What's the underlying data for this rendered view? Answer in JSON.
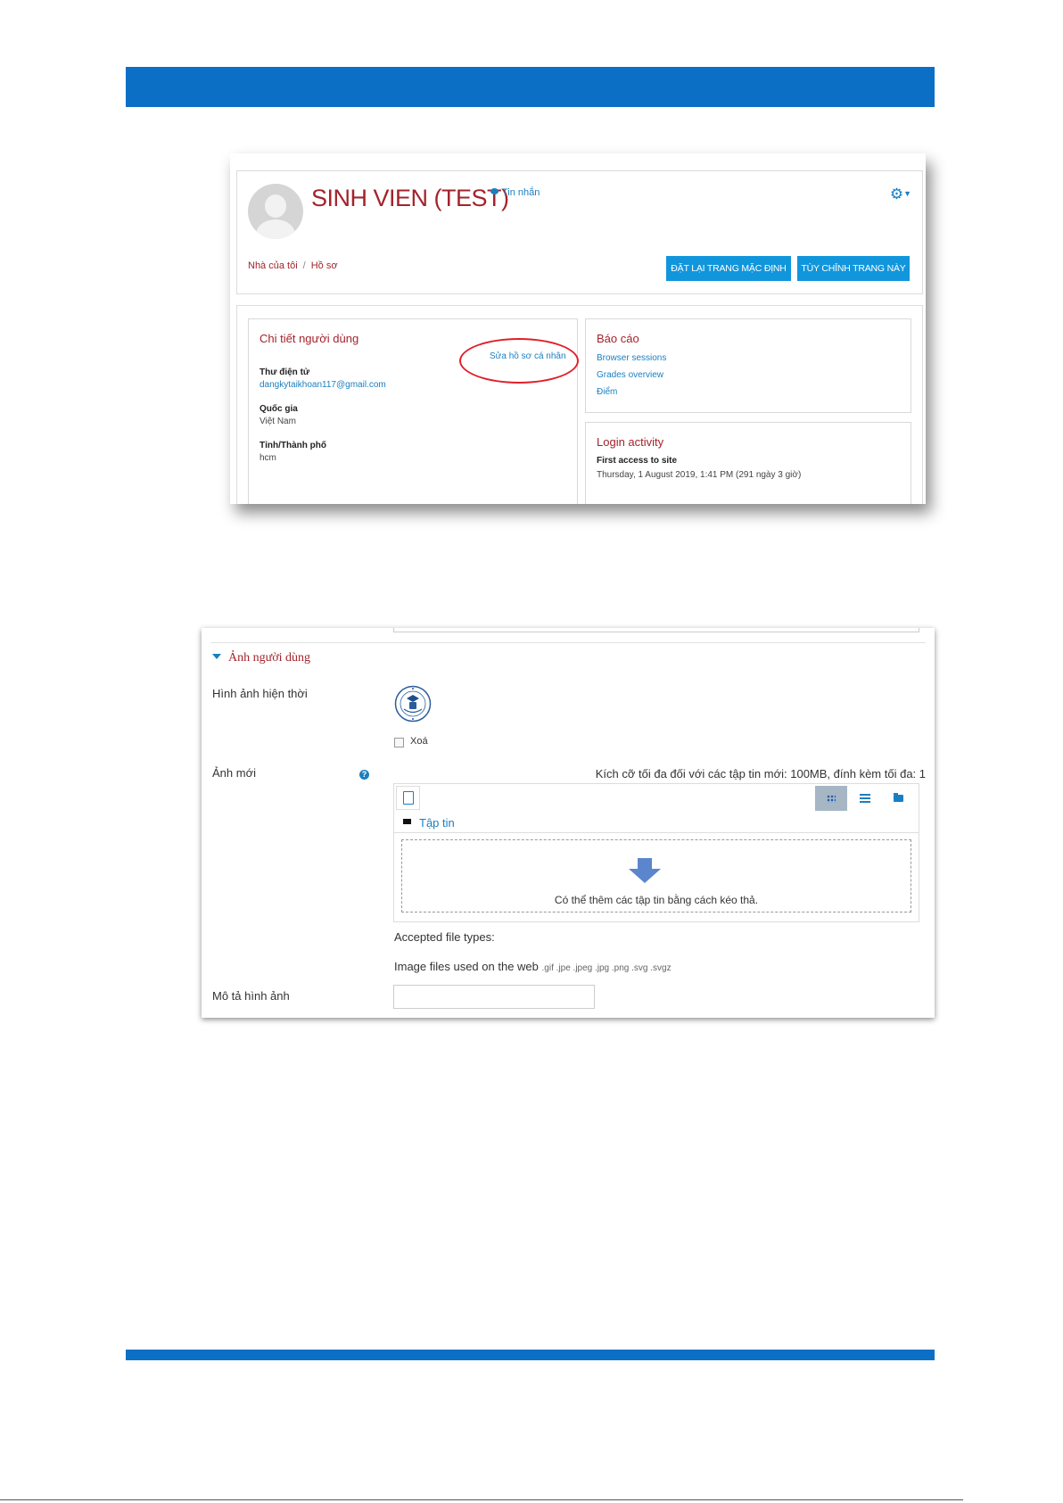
{
  "profile_screenshot": {
    "user_name": "SINH VIEN (TEST)",
    "message_link": "Tin nhắn",
    "breadcrumb": [
      "Nhà của tôi",
      "Hồ sơ"
    ],
    "buttons": {
      "reset": "ĐẶT LẠI TRANG MẶC ĐỊNH",
      "customize": "TÙY CHỈNH TRANG NÀY"
    },
    "user_details": {
      "title": "Chi tiết người dùng",
      "edit_link": "Sửa hồ sơ cá nhân",
      "fields": [
        {
          "label": "Thư điện tử",
          "value": "dangkytaikhoan117@gmail.com"
        },
        {
          "label": "Quốc gia",
          "value": "Việt Nam"
        },
        {
          "label": "Tỉnh/Thành phố",
          "value": "hcm"
        }
      ]
    },
    "reports": {
      "title": "Báo cáo",
      "links": [
        "Browser sessions",
        "Grades overview",
        "Điểm"
      ]
    },
    "login_activity": {
      "title": "Login activity",
      "label": "First access to site",
      "value": "Thursday, 1 August 2019, 1:41 PM  (291 ngày 3 giờ)"
    },
    "colors": {
      "title_red": "#a3232b",
      "link_blue": "#1a7fc1",
      "button_blue": "#1196dc"
    }
  },
  "picture_screenshot": {
    "section_title": "Ảnh người dùng",
    "current_picture_label": "Hình ảnh hiện thời",
    "delete_label": "Xoá",
    "new_picture_label": "Ảnh mới",
    "max_size_text": "Kích cỡ tối đa đối với các tập tin mới: 100MB, đính kèm tối đa: 1",
    "path_label": "Tập tin",
    "dropzone_text": "Có thể thêm các tập tin bằng cách kéo thả.",
    "accepted_label": "Accepted file types:",
    "filetypes_label": "Image files used on the web",
    "filetypes_ext": ".gif .jpe .jpeg .jpg .png .svg .svgz",
    "description_label": "Mô tả hình ảnh",
    "description_value": ""
  },
  "page": {
    "band_color": "#0b6fc6"
  }
}
